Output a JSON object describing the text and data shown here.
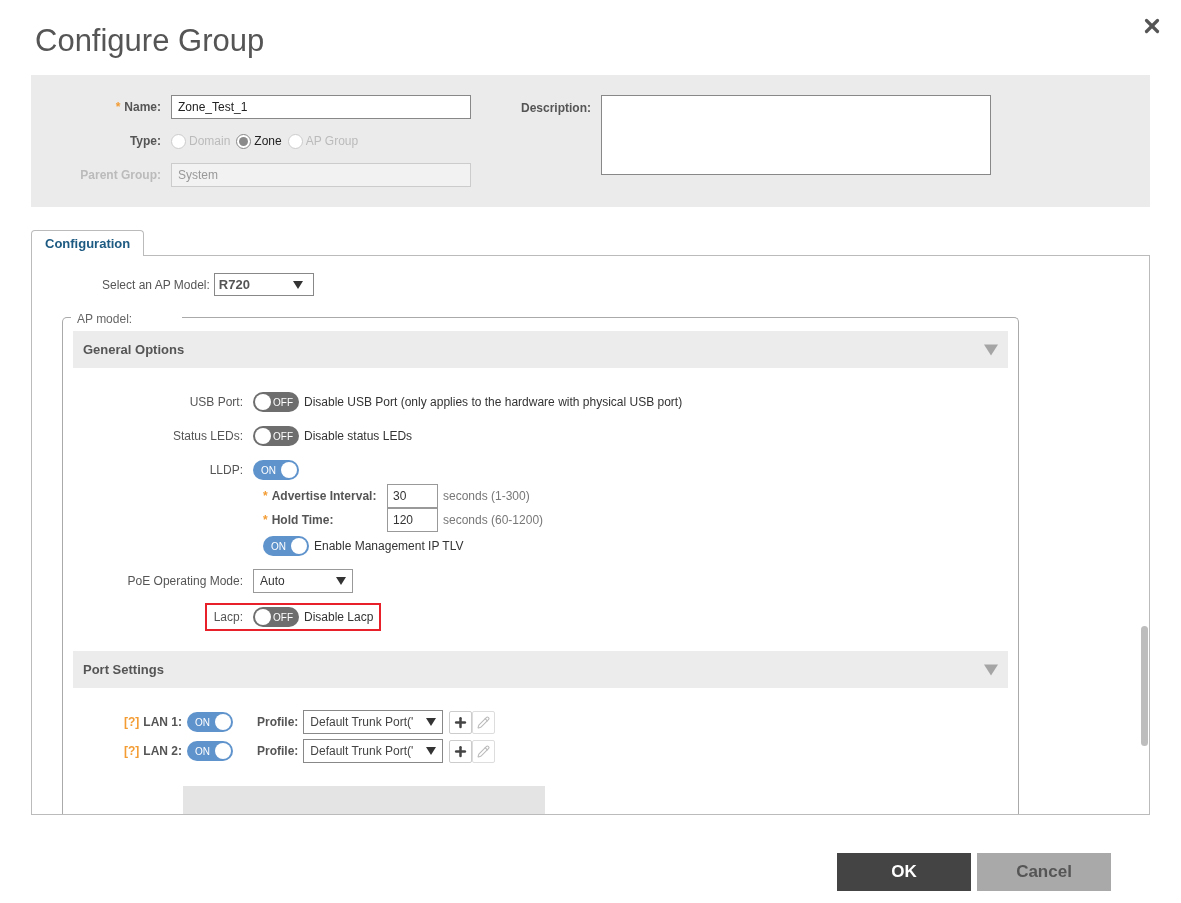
{
  "dialog": {
    "title": "Configure Group"
  },
  "group": {
    "name": {
      "label": "Name:",
      "required_mark": "*",
      "value": "Zone_Test_1"
    },
    "type": {
      "label": "Type:",
      "options": [
        {
          "label": "Domain",
          "selected": false,
          "disabled": true
        },
        {
          "label": "Zone",
          "selected": true,
          "disabled": false
        },
        {
          "label": "AP Group",
          "selected": false,
          "disabled": true
        }
      ]
    },
    "parent_group": {
      "label": "Parent Group:",
      "value": "System",
      "disabled": true
    },
    "description": {
      "label": "Description:"
    }
  },
  "tabs": [
    {
      "label": "Configuration",
      "selected": true
    }
  ],
  "ap_model_select": {
    "label": "Select an AP Model:",
    "value": "R720"
  },
  "fieldset_legend": "AP model:",
  "general_options": {
    "title": "General Options",
    "expanded": true,
    "rows": [
      {
        "kind": "toggle",
        "label": "USB Port:",
        "on": false,
        "state_label": "OFF",
        "description": "Disable USB Port (only applies to the hardware with physical USB port)",
        "highlighted": false
      },
      {
        "kind": "toggle",
        "label": "Status LEDs:",
        "on": false,
        "state_label": "OFF",
        "description": "Disable status LEDs",
        "highlighted": false
      },
      {
        "kind": "toggle",
        "label": "LLDP:",
        "on": true,
        "state_label": "ON",
        "highlighted": false,
        "children": [
          {
            "kind": "field",
            "required_mark": "*",
            "label": "Advertise Interval:",
            "value": "30",
            "hint": "seconds (1-300)"
          },
          {
            "kind": "field",
            "required_mark": "*",
            "label": "Hold Time:",
            "value": "120",
            "hint": "seconds (60-1200)"
          },
          {
            "kind": "toggle",
            "on": true,
            "state_label": "ON",
            "description": "Enable Management IP TLV"
          }
        ]
      },
      {
        "kind": "select",
        "label": "PoE Operating Mode:",
        "value": "Auto",
        "highlighted": false
      },
      {
        "kind": "toggle",
        "label": "Lacp:",
        "on": false,
        "state_label": "OFF",
        "description": "Disable Lacp",
        "highlighted": true
      }
    ]
  },
  "port_settings": {
    "title": "Port Settings",
    "expanded": true,
    "ports": [
      {
        "help": "[?]",
        "label": "LAN 1:",
        "on": true,
        "state_label": "ON",
        "profile_label": "Profile:",
        "profile": "Default Trunk Port('"
      },
      {
        "help": "[?]",
        "label": "LAN 2:",
        "on": true,
        "state_label": "ON",
        "profile_label": "Profile:",
        "profile": "Default Trunk Port('"
      }
    ]
  },
  "buttons": [
    {
      "label": "OK",
      "kind": "primary"
    },
    {
      "label": "Cancel",
      "kind": "secondary"
    }
  ]
}
